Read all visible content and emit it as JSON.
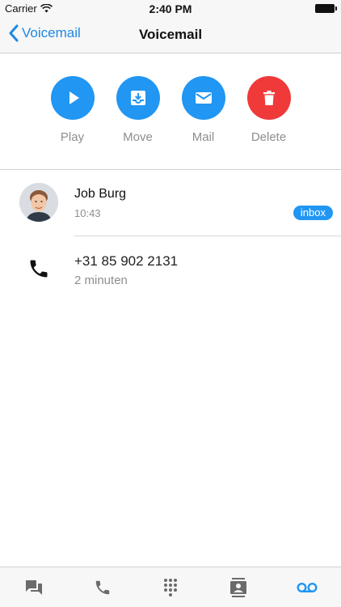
{
  "status": {
    "carrier": "Carrier",
    "time": "2:40 PM"
  },
  "nav": {
    "back_label": "Voicemail",
    "title": "Voicemail"
  },
  "actions": [
    {
      "label": "Play",
      "icon": "play-icon",
      "color": "#2196f3"
    },
    {
      "label": "Move",
      "icon": "move-to-inbox-icon",
      "color": "#2196f3"
    },
    {
      "label": "Mail",
      "icon": "mail-icon",
      "color": "#2196f3"
    },
    {
      "label": "Delete",
      "icon": "trash-icon",
      "color": "#f03a3a"
    }
  ],
  "voicemail": {
    "caller_name": "Job Burg",
    "time": "10:43",
    "folder_badge": "inbox",
    "number": "+31 85 902 2131",
    "duration": "2 minuten"
  },
  "tabs": [
    {
      "icon": "chat-icon",
      "active": false
    },
    {
      "icon": "phone-icon",
      "active": false
    },
    {
      "icon": "dialpad-icon",
      "active": false
    },
    {
      "icon": "contacts-icon",
      "active": false
    },
    {
      "icon": "voicemail-icon",
      "active": true
    }
  ],
  "colors": {
    "accent": "#2196f3",
    "danger": "#f03a3a",
    "secondary_text": "#8e8e93",
    "inactive_tab": "#6b6b6b"
  }
}
